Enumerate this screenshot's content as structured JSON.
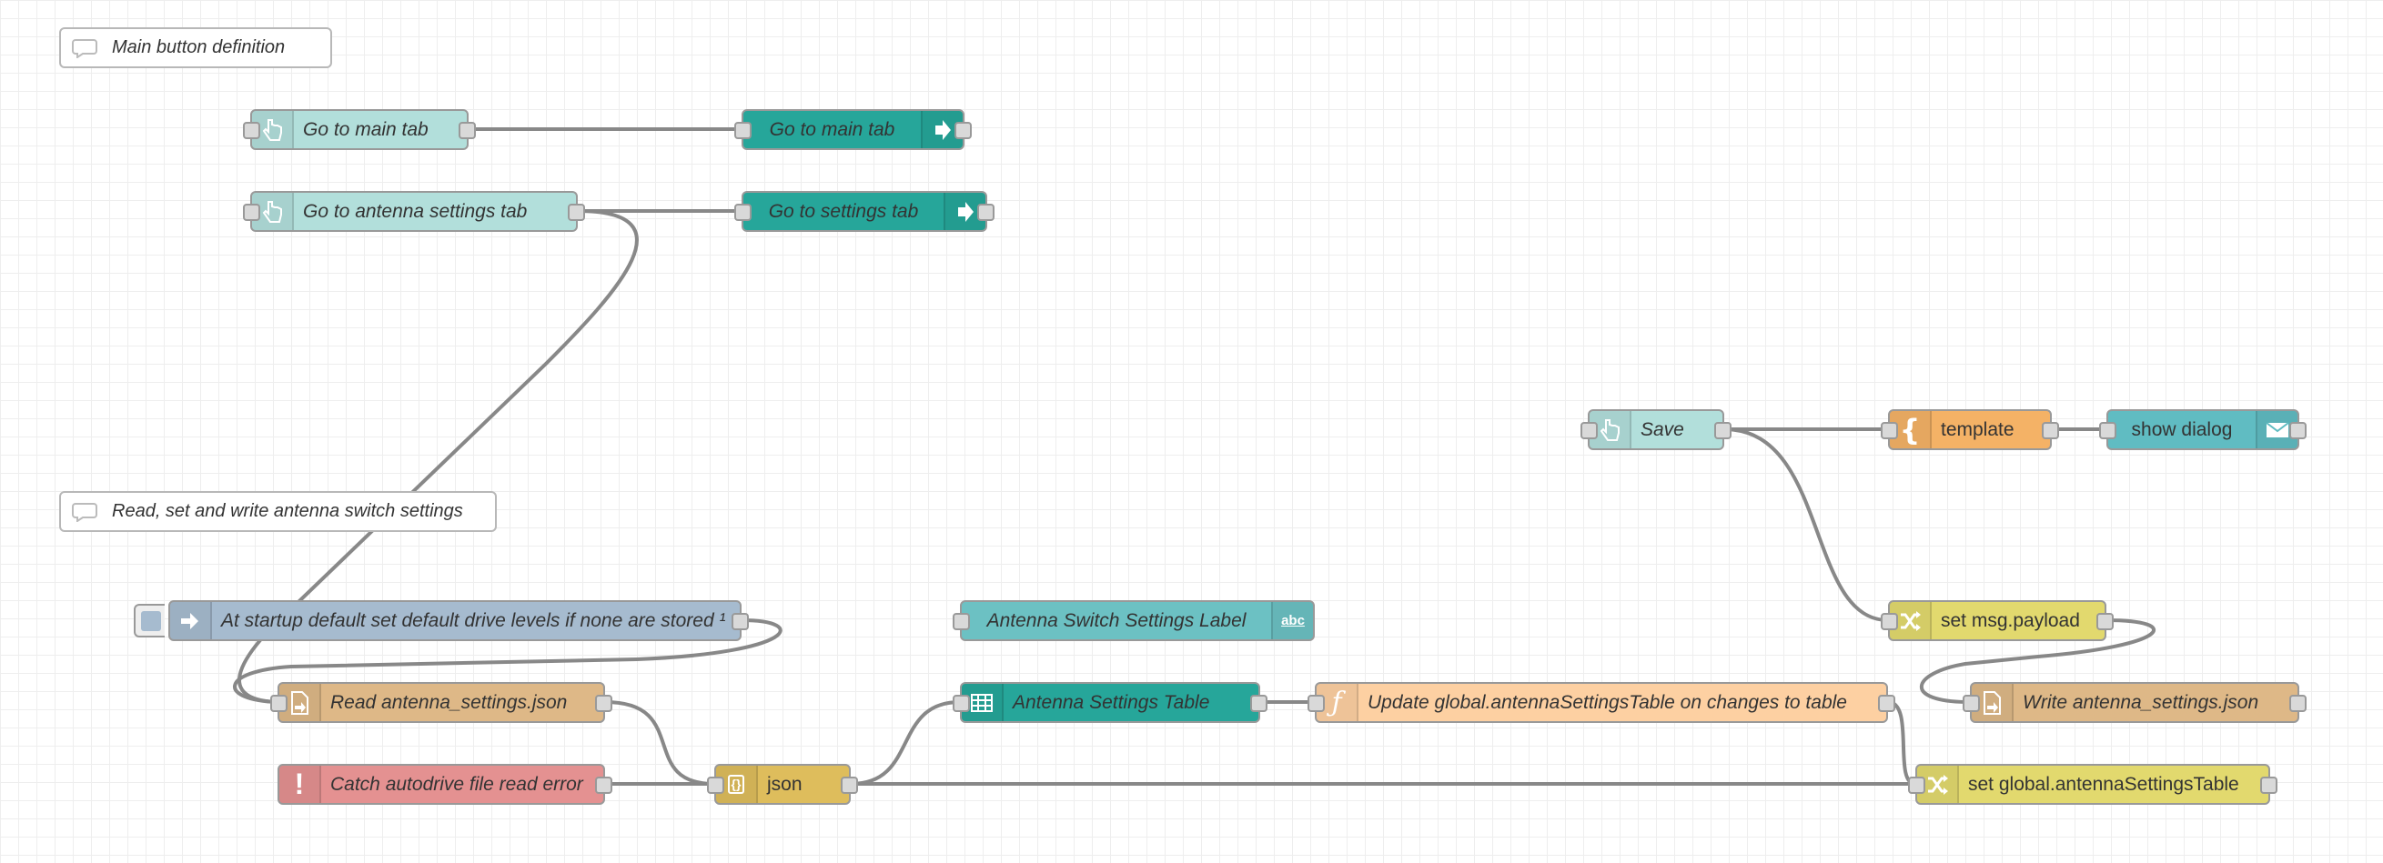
{
  "colors": {
    "ui_button": "#b2dfdb",
    "ui_link": "#26a69a",
    "ui_label": "#6cc1c3",
    "ui_table": "#26a69a",
    "ui_toast": "#60bcc2",
    "inject": "#a6bbcf",
    "file": "#deb887",
    "catch": "#e49191",
    "json": "#debd5c",
    "function": "#fdd0a2",
    "change": "#e2d96e",
    "template": "#f4b266",
    "wire": "#888888"
  },
  "comments": {
    "main_buttons": "Main button definition",
    "antenna_settings": "Read, set and write antenna switch settings"
  },
  "nodes": {
    "goto_main_button": "Go to main tab",
    "goto_main_link": "Go to main tab",
    "goto_antenna_button": "Go to antenna settings tab",
    "goto_settings_link": "Go to settings tab",
    "save_button": "Save",
    "template": "template",
    "show_dialog": "show dialog",
    "startup_inject": "At startup default set default drive levels if none are stored ¹",
    "settings_label": "Antenna Switch Settings Label",
    "set_msg_payload": "set msg.payload",
    "read_file": "Read antenna_settings.json",
    "settings_table": "Antenna Settings Table",
    "update_function": "Update global.antennaSettingsTable on changes to table",
    "write_file": "Write antenna_settings.json",
    "catch_error": "Catch autodrive file read error",
    "json": "json",
    "set_global": "set global.antennaSettingsTable"
  },
  "icons": {
    "comment": "speech-bubble-icon",
    "ui_button": "hand-pointer-icon",
    "ui_link": "link-arrow-icon",
    "inject": "inject-arrow-icon",
    "file_in": "file-in-icon",
    "file_out": "file-out-icon",
    "catch": "exclamation-icon",
    "json": "braces-icon",
    "table": "table-icon",
    "function": "function-icon",
    "change": "shuffle-icon",
    "template": "curly-brace-icon",
    "toast": "envelope-icon",
    "label": "abc-text-icon"
  }
}
